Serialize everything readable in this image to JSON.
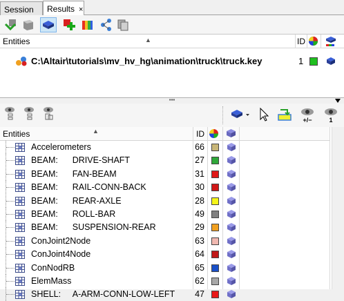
{
  "tabs": [
    {
      "label": "Session",
      "active": false
    },
    {
      "label": "Results",
      "active": true,
      "close": "×"
    }
  ],
  "toolbar_top": {
    "icons": [
      "load-results-icon",
      "open-file-icon",
      "show-model-icon",
      "add-model-icon",
      "contour-icon",
      "assembly-tree-icon",
      "layers-icon"
    ]
  },
  "files_pane": {
    "headers": {
      "entities": "Entities",
      "id": "ID"
    },
    "rows": [
      {
        "path": "C:\\Altair\\tutorials\\mv_hv_hg\\animation\\truck\\truck.key",
        "id": "1",
        "color": "#1fbf1f"
      }
    ]
  },
  "toolbar_bottom": {
    "icons": [
      "show-all-icon",
      "hide-all-icon",
      "isolate-icon",
      "display-mode-icon",
      "select-cursor-icon",
      "highlight-icon",
      "toggle-visibility-icon",
      "isolate-one-icon"
    ],
    "labels": {
      "toggle": "+/−",
      "one": "1"
    }
  },
  "entities_pane": {
    "headers": {
      "entities": "Entities",
      "id": "ID"
    },
    "rows": [
      {
        "name": "Accelerometers",
        "id": "66",
        "color": "#c8b678"
      },
      {
        "name": "BEAM:      DRIVE-SHAFT",
        "id": "27",
        "color": "#2fa83a"
      },
      {
        "name": "BEAM:      FAN-BEAM",
        "id": "31",
        "color": "#e01818"
      },
      {
        "name": "BEAM:      RAIL-CONN-BACK",
        "id": "30",
        "color": "#d01818"
      },
      {
        "name": "BEAM:      REAR-AXLE",
        "id": "28",
        "color": "#f5f51a"
      },
      {
        "name": "BEAM:      ROLL-BAR",
        "id": "49",
        "color": "#808080"
      },
      {
        "name": "BEAM:      SUSPENSION-REAR",
        "id": "29",
        "color": "#f0a020"
      },
      {
        "name": "ConJoint2Node",
        "id": "63",
        "color": "#f0b8b0"
      },
      {
        "name": "ConJoint4Node",
        "id": "64",
        "color": "#c01818"
      },
      {
        "name": "ConNodRB",
        "id": "65",
        "color": "#1a50c8"
      },
      {
        "name": "ElemMass",
        "id": "62",
        "color": "#a8a8a8"
      },
      {
        "name": "SHELL:     A-ARM-CONN-LOW-LEFT",
        "id": "47",
        "color": "#e81818"
      }
    ]
  }
}
